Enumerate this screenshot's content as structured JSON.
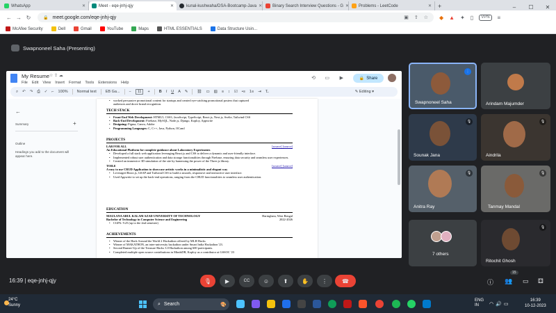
{
  "tabs": [
    {
      "title": "WhatsApp",
      "color": "#25d366",
      "active": false
    },
    {
      "title": "Meet - eqe-jnhj-qjy",
      "color": "#00897b",
      "active": true
    },
    {
      "title": "kunal-kushwaha/DSA-Bootcamp-Java",
      "color": "#24292f",
      "active": false
    },
    {
      "title": "Binary Search Interview Questions - G",
      "color": "#ea4335",
      "active": false
    },
    {
      "title": "Problems - LeetCode",
      "color": "#ffa116",
      "active": false
    }
  ],
  "new_tab": "+",
  "address": {
    "url": "meet.google.com/eqe-jnhj-qjy",
    "vpn": "VPN"
  },
  "bookmarks": [
    {
      "label": "McAfee Security",
      "color": "#c01818"
    },
    {
      "label": "Dell",
      "color": "#f4c20d"
    },
    {
      "label": "Gmail",
      "color": "#ea4335"
    },
    {
      "label": "YouTube",
      "color": "#ff0000"
    },
    {
      "label": "Maps",
      "color": "#34a853"
    },
    {
      "label": "HTML ESSENTIALS",
      "color": "#555555"
    },
    {
      "label": "Data Structure Usin...",
      "color": "#1a73e8"
    }
  ],
  "presenter": "Swapnoneel Saha (Presenting)",
  "doc": {
    "title": "My Resume",
    "menu": [
      "File",
      "Edit",
      "View",
      "Insert",
      "Format",
      "Tools",
      "Extensions",
      "Help"
    ],
    "share": "Share",
    "toolbar": {
      "zoom": "100%",
      "style": "Normal text",
      "font": "EB Ga...",
      "size": "11",
      "editing": "Editing"
    },
    "outline": {
      "summary": "Summary",
      "outline": "Outline",
      "hint": "Headings you add to the document will appear here."
    },
    "top_line1": "worked persuasive promotional content for startups and created eye-catching promotional posters that captured",
    "top_line2": "audiences and drove brand recognition.",
    "tech_stack": "TECH STACK",
    "ts_items": [
      {
        "label": "Front-End Web Development:",
        "text": " HTML5, CSS3, JavaScript, TypeScript, React.js, Next.js, Svelte, Tailwind CSS"
      },
      {
        "label": "Back-End Development:",
        "text": " Firebase, MySQL, Node.js, Django, Koploy, Appwrite"
      },
      {
        "label": "Designing:",
        "text": " Figma, Canva, Adobe"
      },
      {
        "label": "Programming Languages:",
        "text": " C, C++, Java, Python, OCaml"
      }
    ],
    "projects": "PROJECTS",
    "p1": {
      "name": "LAB FOR ALL",
      "links": "[source] [source]",
      "subtitle": "An Educational Platform for complete guidance about Laboratory Experiments",
      "bullets": [
        "Developed a full stack web application leveraging React.js and CSS to deliver a dynamic and user-friendly interface.",
        "Implemented robust user authentication and data storage functionalities through Firebase, ensuring data security and seamless user experiences.",
        "Created an immersive 3D simulation of the site by harnessing the power of the Three.js library."
      ]
    },
    "p2": {
      "name": "TOILE",
      "links": "[source] [source]",
      "subtitle": "A easy to use CRUD Application to showcase artistic works in a minimalistic and elegant way",
      "bullets": [
        "Leveraged React.js, GSAP and Tailwind CSS to build a smooth, responsive and interactive user interface.",
        "Used Appwrite to set up the back-end operations, ranging from the CRUD functionalities to seamless user authentication."
      ]
    },
    "education": "EDUCATION",
    "edu": {
      "school": "MAULANA ABUL KALAM AZAD UNIVERSITY OF TECHNOLOGY",
      "place": "Haringhata, West Bengal",
      "degree": "Bachelor of Technology in Computer Science and Engineering",
      "years": "2022-2026",
      "cgpa": "CGPA: 9.25 (up to the 2nd semester)"
    },
    "achievements": "ACHIEVEMENTS",
    "ach": [
      "Winner of the Hack Around the World 2 Hackathon offered by MLH Hacks",
      "Winner of MAKATHON, an inter-university hackathon under Smart India Hackathon '23.",
      "Second Runner-Up of the Treasure Hacks 3.0 Hackathon among 600 participants.",
      "Completed multiple open source contributions in MindsDB, Koploy as a contributor at GSSOC '23"
    ]
  },
  "participants": [
    {
      "name": "Swapnoneel Saha",
      "muted": false,
      "skin": "#8d5a3b",
      "bg": "#4a5a6a"
    },
    {
      "name": "Arindam Majumder",
      "muted": false,
      "skin": "#c07a4a",
      "bg": "#3c4043"
    },
    {
      "name": "Sounak Jana",
      "muted": true,
      "skin": "#7a5238",
      "bg": "#2e3a4a"
    },
    {
      "name": "Aindrila",
      "muted": true,
      "skin": "#a06a48",
      "bg": "#3b3530"
    },
    {
      "name": "Anitra Ray",
      "muted": true,
      "skin": "#b07a55",
      "bg": "#55606a"
    },
    {
      "name": "Tanmay Mandal",
      "muted": true,
      "skin": "#8a5a3a",
      "bg": "#6a6a68"
    },
    {
      "name": "7 others",
      "muted": false,
      "skin": "#c0a090",
      "bg": "#3c4043"
    },
    {
      "name": "Ritochit Ghosh",
      "muted": true,
      "skin": "#6e4a32",
      "bg": "#2a2a2e"
    }
  ],
  "meeting": {
    "time": "16:39",
    "code": "eqe-jnhj-qjy",
    "participant_count": "15"
  },
  "taskbar": {
    "temp": "24°C",
    "weather": "Sunny",
    "search": "Search",
    "lang1": "ENG",
    "lang2": "IN",
    "clock": "16:39",
    "date": "10-12-2023"
  },
  "colors": {
    "accent": "#1a73e8",
    "end_call": "#ea4335"
  }
}
